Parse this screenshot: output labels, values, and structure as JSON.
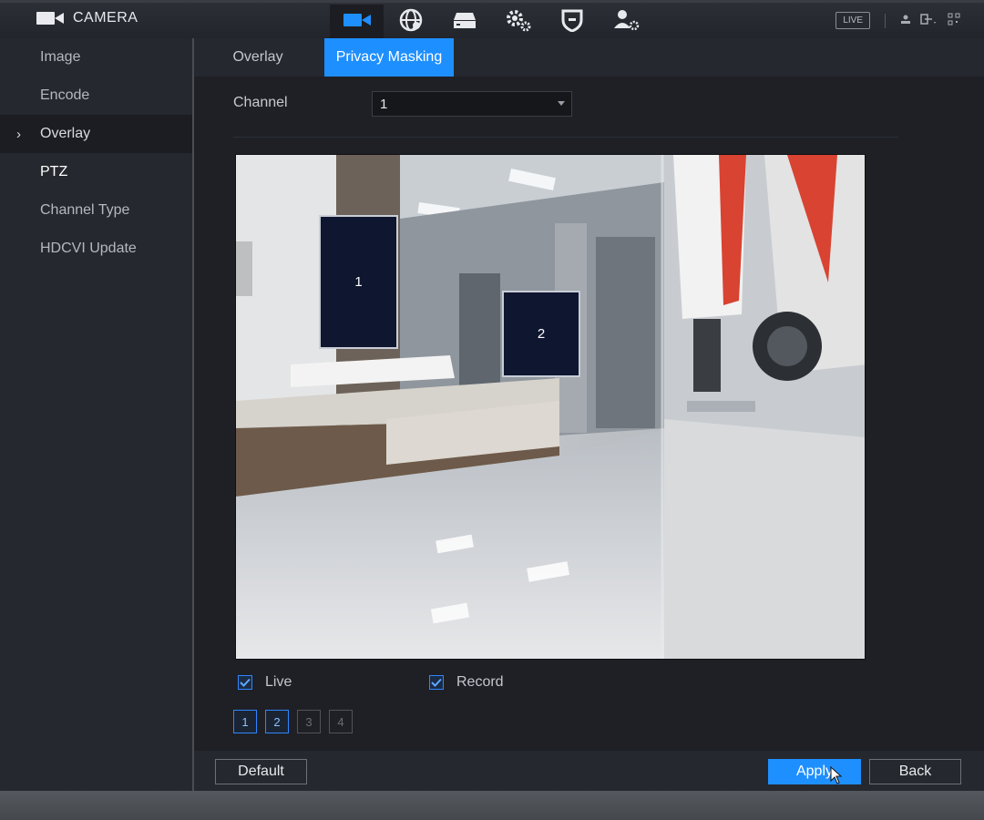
{
  "app": {
    "title": "CAMERA"
  },
  "topbar": {
    "icons": [
      "camera-icon",
      "network-icon",
      "storage-icon",
      "system-settings-icon",
      "security-shield-icon",
      "account-icon"
    ],
    "live_badge": "LIVE"
  },
  "sidebar": {
    "items": [
      {
        "label": "Image"
      },
      {
        "label": "Encode"
      },
      {
        "label": "Overlay"
      },
      {
        "label": "PTZ"
      },
      {
        "label": "Channel Type"
      },
      {
        "label": "HDCVI Update"
      }
    ],
    "active": "Overlay"
  },
  "tabs": [
    {
      "label": "Overlay"
    },
    {
      "label": "Privacy Masking"
    }
  ],
  "active_tab": "Privacy Masking",
  "channel": {
    "label": "Channel",
    "value": "1"
  },
  "masks": [
    {
      "label": "1"
    },
    {
      "label": "2"
    }
  ],
  "options": {
    "live": {
      "label": "Live",
      "checked": true
    },
    "record": {
      "label": "Record",
      "checked": true
    }
  },
  "zones": [
    {
      "label": "1",
      "enabled": true
    },
    {
      "label": "2",
      "enabled": true
    },
    {
      "label": "3",
      "enabled": false
    },
    {
      "label": "4",
      "enabled": false
    }
  ],
  "buttons": {
    "default": "Default",
    "apply": "Apply",
    "back": "Back"
  },
  "colors": {
    "accent": "#1e8fff",
    "mask_fill": "#0e1630",
    "panel": "#1e2026",
    "sidebar": "#25282e"
  }
}
